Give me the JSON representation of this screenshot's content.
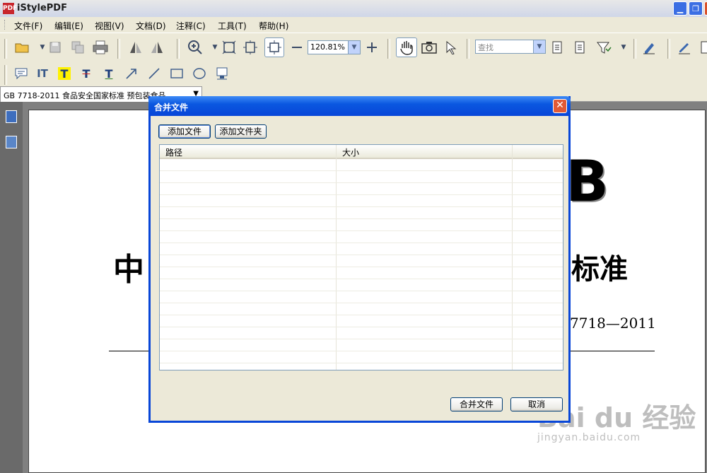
{
  "window": {
    "title": "iStylePDF",
    "app_icon_text": "PDF",
    "min": "▁",
    "max": "❐"
  },
  "menu": [
    "文件(F)",
    "编辑(E)",
    "视图(V)",
    "文档(D)",
    "注释(C)",
    "工具(T)",
    "帮助(H)"
  ],
  "toolbar": {
    "zoom_value": "120.81%",
    "find_placeholder": "查找"
  },
  "document_tab": {
    "title": "GB 7718-2011 食品安全国家标准 预包装食品"
  },
  "document_page": {
    "big_letter": "B",
    "heading_left": "中",
    "heading_right": "标准",
    "std_number": "7718—2011"
  },
  "dialog": {
    "title": "合并文件",
    "add_file": "添加文件",
    "add_folder": "添加文件夹",
    "columns": [
      "路径",
      "大小",
      ""
    ],
    "merge": "合并文件",
    "cancel": "取消",
    "close": "✕"
  },
  "watermark": {
    "logo": "Bai du 经验",
    "url": "jingyan.baidu.com"
  },
  "colors": {
    "title_blue": "#0846D8",
    "close_red": "#E05A36"
  }
}
